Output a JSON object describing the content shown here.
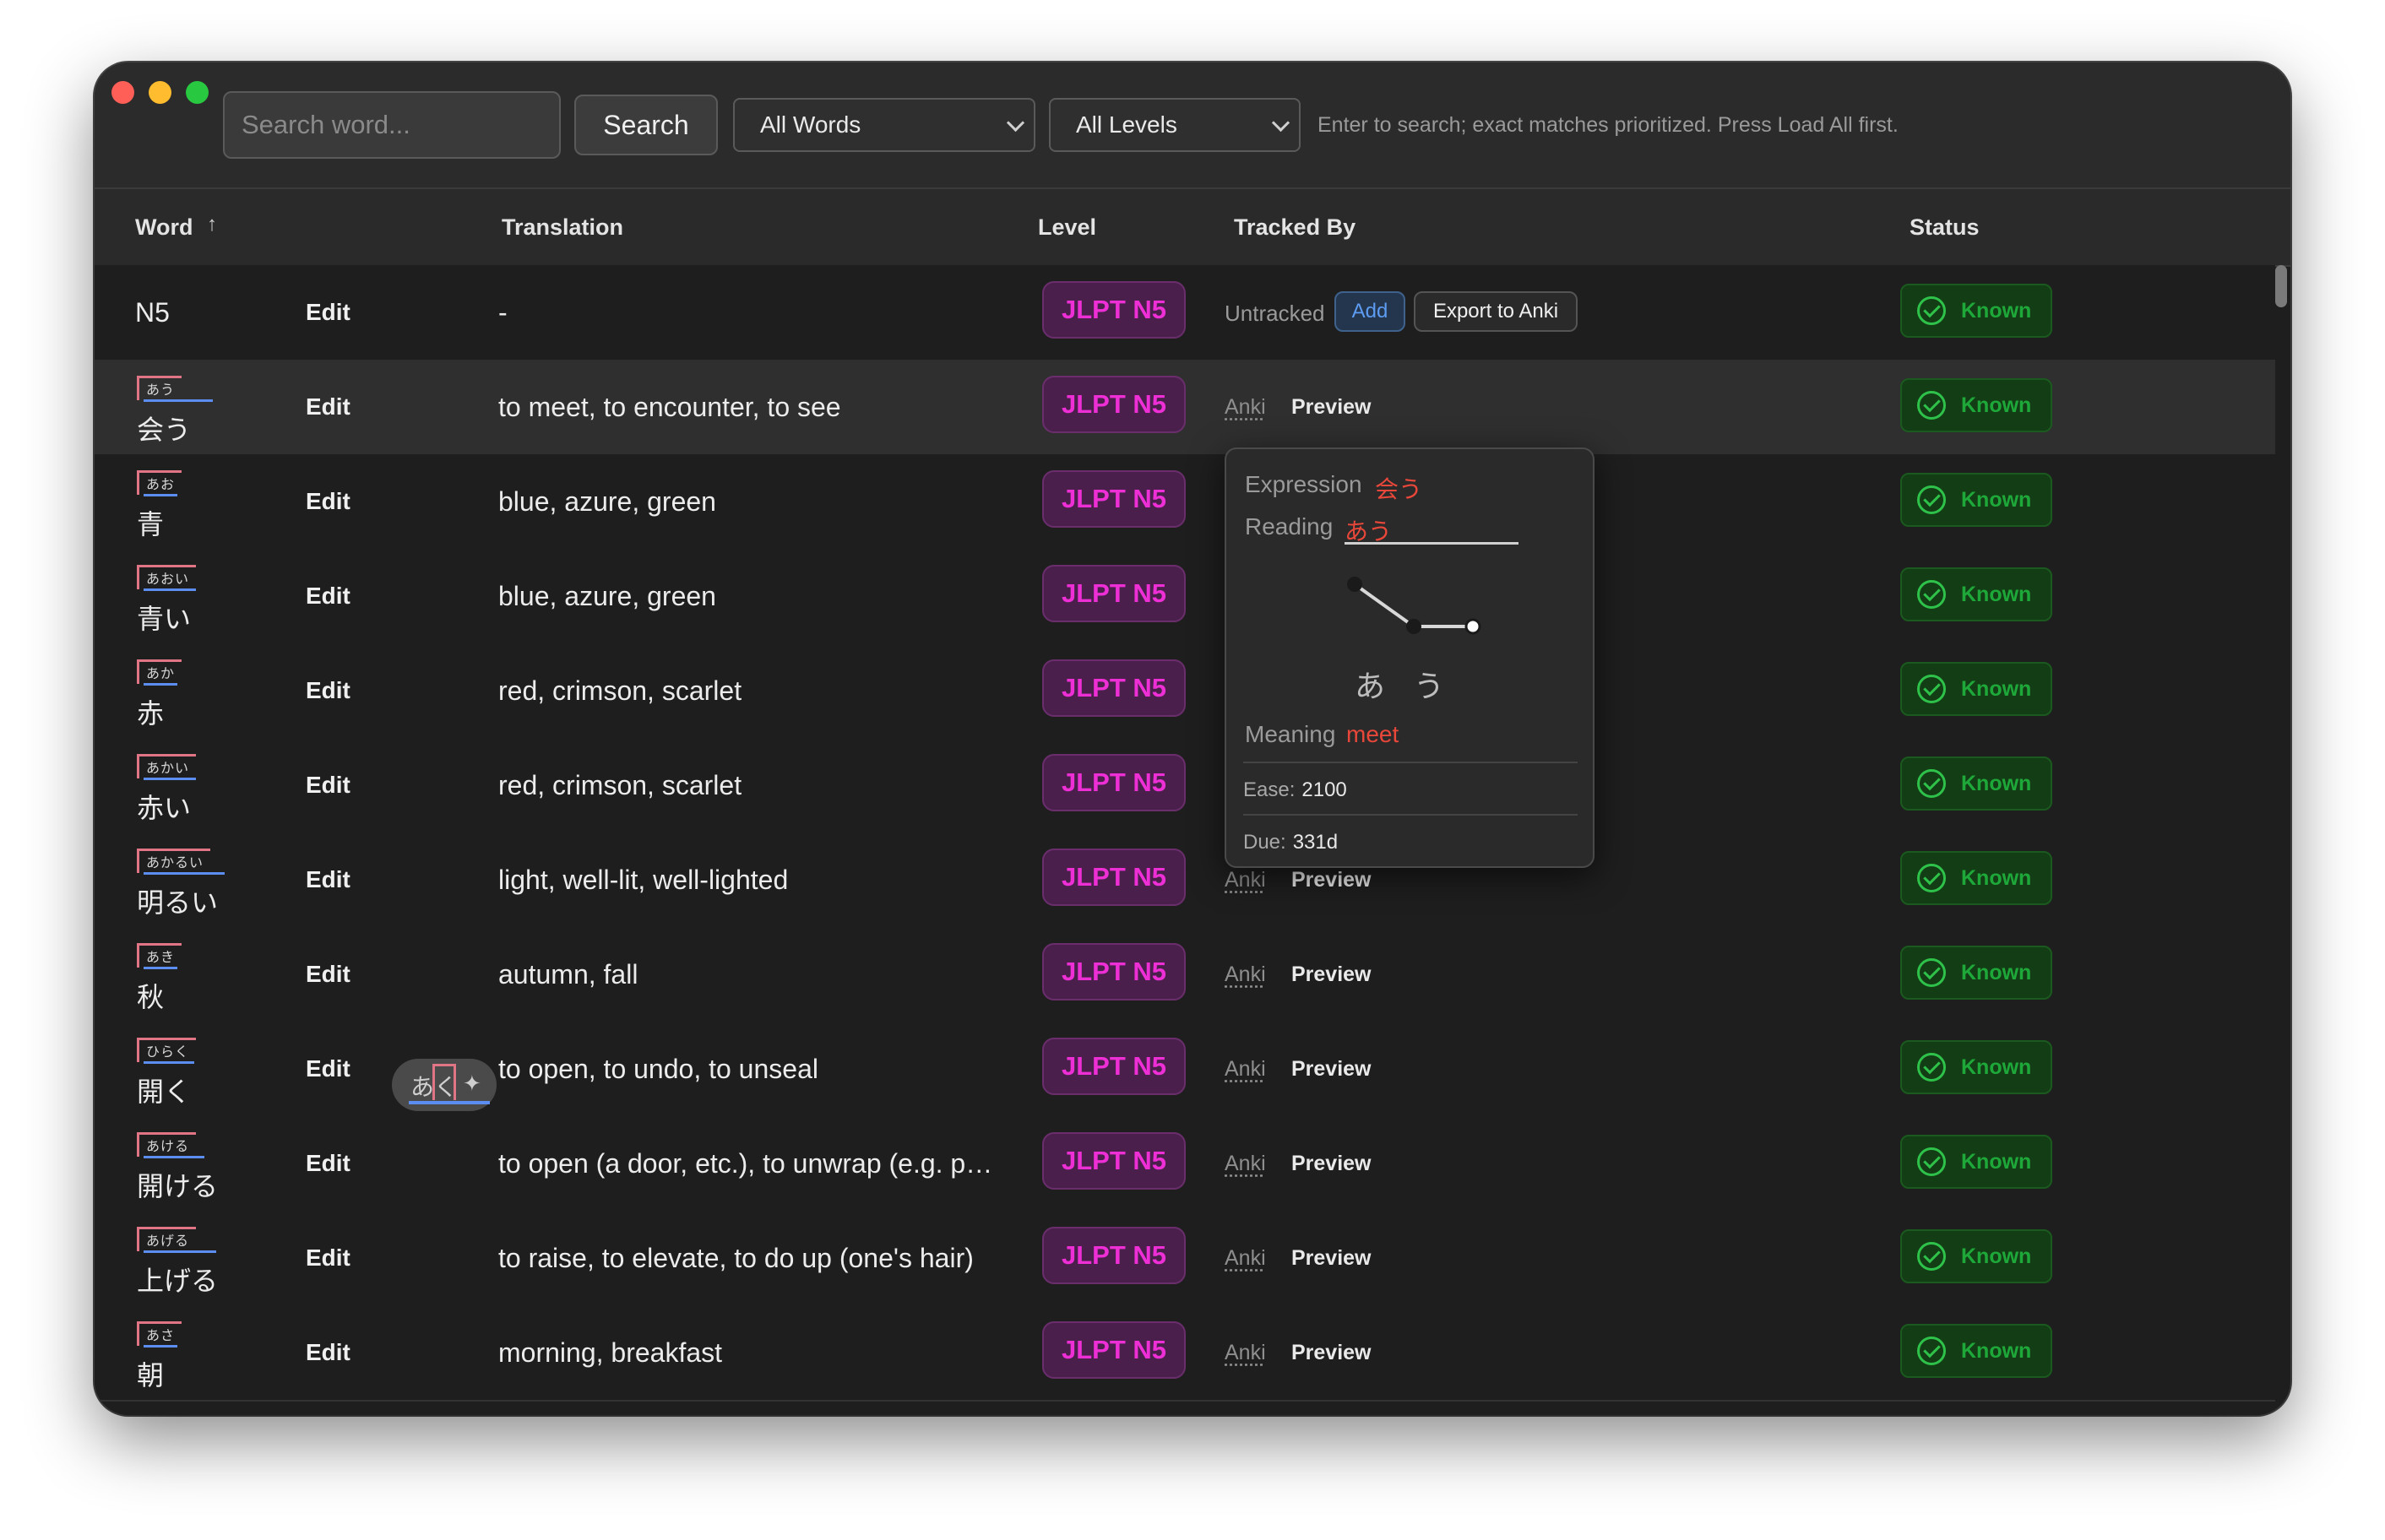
{
  "toolbar": {
    "search_placeholder": "Search word...",
    "search_button": "Search",
    "filter_words": "All Words",
    "filter_levels": "All Levels",
    "hint": "Enter to search; exact matches prioritized. Press Load All first."
  },
  "columns": {
    "word": "Word",
    "translation": "Translation",
    "level": "Level",
    "tracked_by": "Tracked By",
    "status": "Status"
  },
  "rows": [
    {
      "word": "N5",
      "edit": "Edit",
      "translation": "-",
      "level": "JLPT N5",
      "untracked": "Untracked",
      "add": "Add",
      "export": "Export to Anki",
      "status": "Known"
    },
    {
      "reading": "あう",
      "kanji": "会う",
      "edit": "Edit",
      "translation": "to meet, to encounter, to see",
      "level": "JLPT N5",
      "anki": "Anki",
      "preview": "Preview",
      "status": "Known"
    },
    {
      "reading": "あお",
      "kanji": "青",
      "edit": "Edit",
      "translation": "blue, azure, green",
      "level": "JLPT N5",
      "status": "Known"
    },
    {
      "reading": "あおい",
      "kanji": "青い",
      "edit": "Edit",
      "translation": "blue, azure, green",
      "level": "JLPT N5",
      "status": "Known"
    },
    {
      "reading": "あか",
      "kanji": "赤",
      "edit": "Edit",
      "translation": "red, crimson, scarlet",
      "level": "JLPT N5",
      "status": "Known"
    },
    {
      "reading": "あかい",
      "kanji": "赤い",
      "edit": "Edit",
      "translation": "red, crimson, scarlet",
      "level": "JLPT N5",
      "status": "Known"
    },
    {
      "reading": "あかるい",
      "kanji": "明るい",
      "edit": "Edit",
      "translation": "light, well-lit, well-lighted",
      "level": "JLPT N5",
      "anki": "Anki",
      "preview": "Preview",
      "status": "Known"
    },
    {
      "reading": "あき",
      "kanji": "秋",
      "edit": "Edit",
      "translation": "autumn, fall",
      "level": "JLPT N5",
      "anki": "Anki",
      "preview": "Preview",
      "status": "Known"
    },
    {
      "reading": "ひらく",
      "kanji": "開く",
      "edit": "Edit",
      "translation": "to open, to undo, to unseal",
      "level": "JLPT N5",
      "anki": "Anki",
      "preview": "Preview",
      "status": "Known"
    },
    {
      "reading": "あける",
      "kanji": "開ける",
      "edit": "Edit",
      "translation": "to open (a door, etc.), to unwrap (e.g. p…",
      "level": "JLPT N5",
      "anki": "Anki",
      "preview": "Preview",
      "status": "Known"
    },
    {
      "reading": "あげる",
      "kanji": "上げる",
      "edit": "Edit",
      "translation": "to raise, to elevate, to do up (one's hair)",
      "level": "JLPT N5",
      "anki": "Anki",
      "preview": "Preview",
      "status": "Known"
    },
    {
      "reading": "あさ",
      "kanji": "朝",
      "edit": "Edit",
      "translation": "morning, breakfast",
      "level": "JLPT N5",
      "anki": "Anki",
      "preview": "Preview",
      "status": "Known"
    }
  ],
  "popover": {
    "expression_label": "Expression",
    "expression": "会う",
    "reading_label": "Reading",
    "reading": "あう",
    "pitch_kana": [
      "あ",
      "う"
    ],
    "meaning_label": "Meaning",
    "meaning": "meet",
    "ease_label": "Ease:",
    "ease": "2100",
    "due_label": "Due:",
    "due": "331d"
  },
  "tooltip": {
    "kana": "あく",
    "icon": "sparkle-icon"
  },
  "colors": {
    "jlpt_badge_text": "#ee2fd6",
    "known_text": "#1fa83a",
    "popover_red": "#e8473a",
    "add_blue": "#5d9cf2"
  }
}
